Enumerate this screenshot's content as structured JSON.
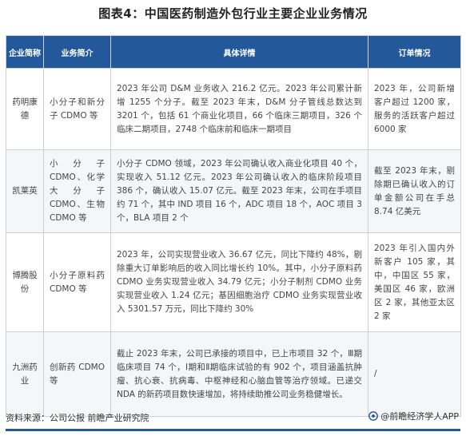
{
  "title": "图表4：中国医药制造外包行业主要企业业务情况",
  "table": {
    "headers": [
      "企业简称",
      "业务简介",
      "具体详情",
      "订单情况"
    ],
    "rows": [
      {
        "company": "药明康德",
        "business": "小分子和新分子 CDMO 等",
        "details": "2023 年公司 D&M 业务收入 216.2 亿元。2023 年公司累计新增 1255 个分子。截至 2023 年末，D&M 分子管线总数达到 3201 个，包括 61 个商业化项目，66 个临床三期项目，326 个临床二期项目，2748 个临床前和临床一期项目",
        "orders": "2023 年，公司新增客户超过 1200 家，服务的活跃客户超过 6000 家"
      },
      {
        "company": "凯莱英",
        "business": "小分子 CDMO、化学大分子 CDMO、生物 CDMO 等",
        "details": "小分子 CDMO 领域，2023 年公司确认收入商业化项目 40 个，实现收入 51.12 亿元。2023 年公司确认收入的临床阶段项目 386 个，确认收入 15.07 亿元。截至 2023 年末，公司在手项目约 71 个，其中 IND 项目 16 个，ADC 项目 18 个，AOC 项目 3 个，BLA 项目 2 个",
        "orders": "截至 2023 年末，剔除期已确认收入的订单金额公司在手总 8.74 亿美元"
      },
      {
        "company": "博腾股份",
        "business": "小分子原料药 CDMO 等",
        "details": "2023 年，公司实现营业收入 36.67 亿元，同比下降约 48%，剔除重大订单影响后的收入同比增长约 10%。其中，小分子原料药 CDMO 业务实现营业收入 34.79 亿元；小分子制剂 CDMO 业务实现营业收入 1.24 亿元；基因细胞治疗 CDMO 业务实现营业收入 5301.57 万元，同比下降约 30%",
        "orders": "2023 年引入国内外新客户 105 家，其中，中国区 55 家，美国区 46 家，欧洲区 2 家，其他亚太区 2 家"
      },
      {
        "company": "九洲药业",
        "business": "创新药 CDMO 等",
        "details": "截止 2023 年末，公司已承接的项目中，已上市项目 32 个，Ⅲ期临床项目 74 个，Ⅰ期和Ⅱ期临床试验的有 902 个，项目涵盖抗肿瘤、抗心衰、抗病毒、中枢神经和心脑血管等治疗领域。已递交 NDA 的新药项目数快速增加，将持续助推公司业务稳健增长。",
        "orders": "/"
      }
    ]
  },
  "source": "资料来源：公司公报 前瞻产业研究院",
  "brand": "@前瞻经济学人APP"
}
